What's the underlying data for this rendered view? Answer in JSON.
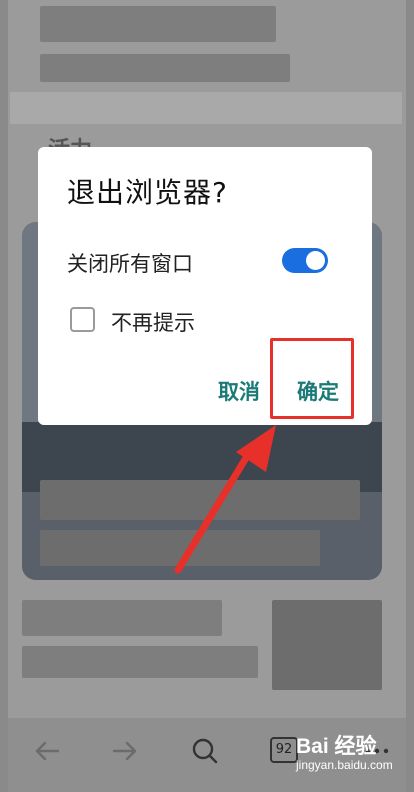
{
  "dialog": {
    "title": "退出浏览器?",
    "close_all_label": "关闭所有窗口",
    "close_all_enabled": true,
    "dont_remind_label": "不再提示",
    "dont_remind_checked": false,
    "cancel_label": "取消",
    "confirm_label": "确定"
  },
  "background": {
    "section_heading": "活力"
  },
  "toolbar": {
    "back_icon": "arrow-left-icon",
    "forward_icon": "arrow-right-icon",
    "search_icon": "search-icon",
    "tab_count": "92",
    "menu_icon": "more-dots-icon"
  },
  "watermark": {
    "logo": "Bai 经验",
    "url": "jingyan.baidu.com"
  },
  "colors": {
    "accent": "#1a6ee0",
    "button_text": "#1b7a78",
    "highlight": "#e8302a"
  }
}
